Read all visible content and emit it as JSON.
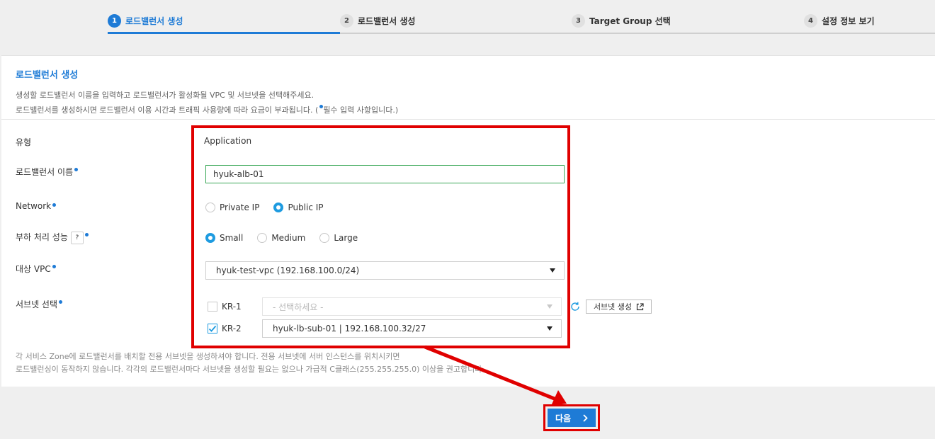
{
  "stepper": {
    "steps": [
      {
        "num": "1",
        "label": "로드밸런서 생성"
      },
      {
        "num": "2",
        "label": "로드밸런서 생성"
      },
      {
        "num": "3",
        "label": "Target Group 선택"
      },
      {
        "num": "4",
        "label": "설정 정보 보기"
      }
    ],
    "active_index": 0
  },
  "section": {
    "title": "로드밸런서 생성",
    "desc_line1": "생성할 로드밸런서 이름을 입력하고 로드밸런서가 활성화될 VPC 및 서브넷을 선택해주세요.",
    "desc_line2_prefix": "로드밸런서를 생성하시면 로드밸런서 이용 시간과 트래픽 사용량에 따라 요금이 부과됩니다. (",
    "desc_line2_suffix": "필수 입력 사항입니다.)"
  },
  "form": {
    "type": {
      "label": "유형",
      "value": "Application"
    },
    "name": {
      "label": "로드밸런서 이름",
      "value": "hyuk-alb-01"
    },
    "network": {
      "label": "Network",
      "options": [
        "Private IP",
        "Public IP"
      ],
      "selected": "Public IP"
    },
    "performance": {
      "label": "부하 처리 성능",
      "help_icon": "question-icon",
      "options": [
        "Small",
        "Medium",
        "Large"
      ],
      "selected": "Small"
    },
    "vpc": {
      "label": "대상 VPC",
      "value": "hyuk-test-vpc (192.168.100.0/24)"
    },
    "subnet": {
      "label": "서브넷 선택",
      "rows": [
        {
          "zone": "KR-1",
          "checked": false,
          "value": "- 선택하세요 -",
          "disabled": true
        },
        {
          "zone": "KR-2",
          "checked": true,
          "value": "hyuk-lb-sub-01 | 192.168.100.32/27",
          "disabled": false
        }
      ],
      "create_button": "서브넷 생성",
      "refresh_icon": "refresh-icon",
      "external_icon": "external-link-icon"
    }
  },
  "footnote": {
    "line1": "각 서비스 Zone에 로드밸런서를 배치할 전용 서브넷을 생성하셔야 합니다. 전용 서브넷에 서버 인스턴스를 위치시키면",
    "line2": "로드밸런싱이 동작하지 않습니다. 각각의 로드밸런서마다 서브넷을 생성할 필요는 없으나 가급적 C클래스(255.255.255.0) 이상을 권고합니다."
  },
  "next_button": {
    "label": "다음"
  },
  "colors": {
    "accent": "#1e7bd6",
    "annotation": "#e00000",
    "valid": "#3aa757"
  }
}
